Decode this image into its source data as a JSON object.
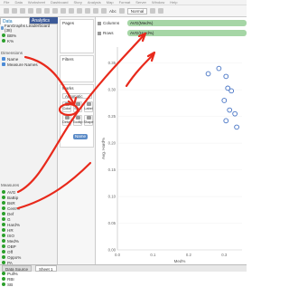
{
  "menu": {
    "items": [
      "File",
      "Data",
      "Worksheet",
      "Dashboard",
      "Story",
      "Analysis",
      "Map",
      "Format",
      "Server",
      "Window",
      "Help"
    ]
  },
  "toolbar": {
    "text_label": "Abc",
    "fit_value": "Normal"
  },
  "data_pane": {
    "tabs": [
      "Data",
      "Analytics"
    ],
    "datasource": "FanGraphs Leaderboard (38)",
    "top_fields": [
      "BB%",
      "K%"
    ],
    "dimensions_header": "Dimensions",
    "dimensions": [
      "Name",
      "Measure Names"
    ],
    "measures_header": "Measures",
    "measures": [
      "AVG",
      "BaBip",
      "BsR",
      "Cent%",
      "Def",
      "G",
      "Hard%",
      "HR",
      "ISO",
      "Med%",
      "OBP",
      "Off",
      "Oppo%",
      "PA",
      "Playerid",
      "Pull%",
      "RBI",
      "SB"
    ]
  },
  "shelves": {
    "pages_title": "Pages",
    "filters_title": "Filters",
    "marks_title": "Marks",
    "mark_type": "Automatic",
    "mark_buttons": [
      "Color",
      "Size",
      "Label",
      "Detail",
      "Tooltip",
      "Shape"
    ],
    "detail_pill": "Name",
    "columns_label": "Columns",
    "columns_pill": "AVG(Med%)",
    "rows_label": "Rows",
    "rows_pill": "AVG(Hard%)"
  },
  "sheet_tabs": [
    "Data Source",
    "Sheet 1"
  ],
  "colors": {
    "accent_green": "#5aaa5a",
    "annotation_red": "#e8291b",
    "point_blue": "#4472c4"
  },
  "chart_data": {
    "type": "scatter",
    "xlabel": "Med%",
    "ylabel": "Avg. Hard%",
    "xlim": [
      0.0,
      0.35
    ],
    "ylim": [
      0.0,
      0.38
    ],
    "x_ticks": [
      "0.0",
      "0.1",
      "0.2",
      "0.3"
    ],
    "y_ticks": [
      "0.00",
      "0.05",
      "0.10",
      "0.15",
      "0.20",
      "0.25",
      "0.30",
      "0.35"
    ],
    "points": [
      {
        "x": 0.255,
        "y": 0.33
      },
      {
        "x": 0.285,
        "y": 0.34
      },
      {
        "x": 0.305,
        "y": 0.325
      },
      {
        "x": 0.31,
        "y": 0.303
      },
      {
        "x": 0.3,
        "y": 0.28
      },
      {
        "x": 0.32,
        "y": 0.298
      },
      {
        "x": 0.315,
        "y": 0.262
      },
      {
        "x": 0.33,
        "y": 0.255
      },
      {
        "x": 0.305,
        "y": 0.242
      },
      {
        "x": 0.335,
        "y": 0.23
      }
    ]
  }
}
